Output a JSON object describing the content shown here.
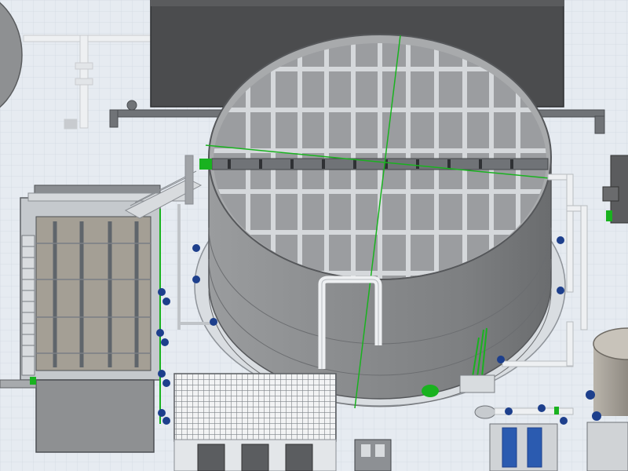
{
  "scene": {
    "kind": "3d-cad-render",
    "subject": "water-treatment-plant",
    "colors": {
      "ground": "#e6ebf1",
      "tank_wall": "#8b8d8f",
      "tank_wall_dark": "#6e7072",
      "tank_rim": "#a7a9ab",
      "tank_interior": "#9a9ca0",
      "grid": "#d6d9dc",
      "building_roof": "#4c4d4f",
      "pipe_white": "#e9ecee",
      "pipe_dark": "#6e7175",
      "highlight_green": "#19b21f",
      "valve_blue": "#1d3f8c",
      "filter_media": "#a39e94",
      "louver": "#8c9096"
    }
  }
}
